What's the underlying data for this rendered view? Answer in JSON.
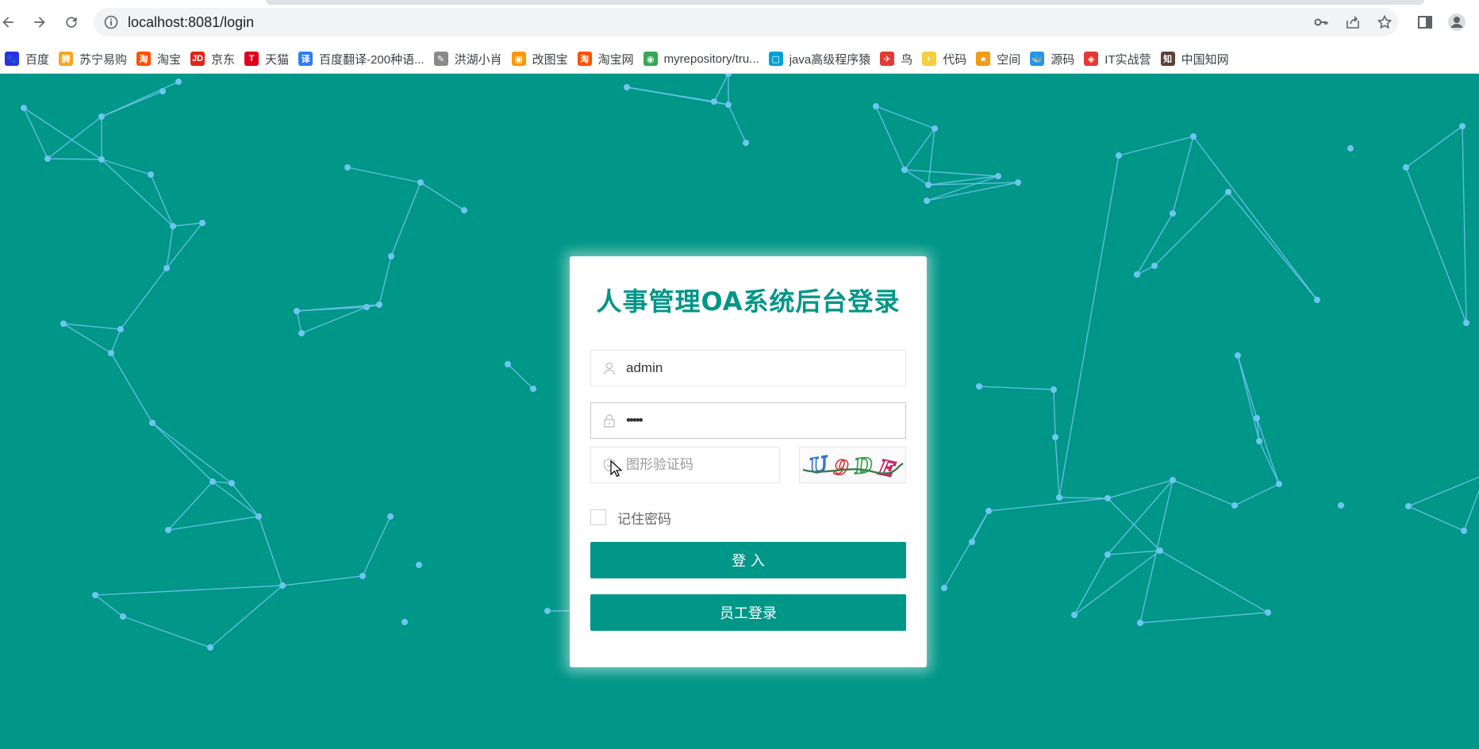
{
  "browser": {
    "url": "localhost:8081/login",
    "bookmarks": [
      {
        "label": "百度",
        "icon": "baidu-paw-icon",
        "color": "#2932e1",
        "glyph": "🐾"
      },
      {
        "label": "苏宁易购",
        "icon": "suning-lion-icon",
        "color": "#f5a623",
        "glyph": "狮"
      },
      {
        "label": "淘宝",
        "icon": "taobao-icon",
        "color": "#ff5000",
        "glyph": "淘"
      },
      {
        "label": "京东",
        "icon": "jd-icon",
        "color": "#e1251b",
        "glyph": "JD"
      },
      {
        "label": "天猫",
        "icon": "tmall-icon",
        "color": "#e1001a",
        "glyph": "T"
      },
      {
        "label": "百度翻译-200种语...",
        "icon": "baidu-translate-icon",
        "color": "#2f7cf6",
        "glyph": "译"
      },
      {
        "label": "洪湖小肖",
        "icon": "feather-icon",
        "color": "#8a8a8a",
        "glyph": "✎"
      },
      {
        "label": "改图宝",
        "icon": "gaitubao-icon",
        "color": "#ff9800",
        "glyph": "▣"
      },
      {
        "label": "淘宝网",
        "icon": "taobao-net-icon",
        "color": "#ff5000",
        "glyph": "淘"
      },
      {
        "label": "myrepository/tru...",
        "icon": "chrome-icon",
        "color": "#34a853",
        "glyph": "◉"
      },
      {
        "label": "java高级程序猿",
        "icon": "bilibili-icon",
        "color": "#00a1d6",
        "glyph": "▢"
      },
      {
        "label": "鸟",
        "icon": "bird-icon",
        "color": "#e53935",
        "glyph": "✈"
      },
      {
        "label": "代码",
        "icon": "code-icon",
        "color": "#f4d03f",
        "glyph": "◐"
      },
      {
        "label": "空间",
        "icon": "qzone-icon",
        "color": "#f39c12",
        "glyph": "★"
      },
      {
        "label": "源码",
        "icon": "docker-whale-icon",
        "color": "#2496ed",
        "glyph": "🐳"
      },
      {
        "label": "IT实战营",
        "icon": "it-camp-icon",
        "color": "#e53935",
        "glyph": "◈"
      },
      {
        "label": "中国知网",
        "icon": "cnki-icon",
        "color": "#5d4037",
        "glyph": "知"
      }
    ]
  },
  "login": {
    "title": "人事管理OA系统后台登录",
    "username_value": "admin",
    "password_value": "•••••",
    "captcha_placeholder": "图形验证码",
    "captcha_text": "U9DE",
    "remember_label": "记住密码",
    "login_button": "登 入",
    "employee_login_button": "员工登录"
  },
  "colors": {
    "page_background": "#009688",
    "network_lines": "#6ec6f0",
    "accent": "#009688"
  }
}
